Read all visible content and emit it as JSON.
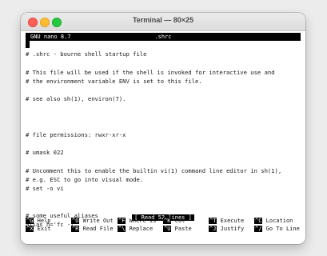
{
  "window": {
    "title": "Terminal — 80×25"
  },
  "nano": {
    "app": "GNU nano 8.7",
    "filename": ".shrc",
    "status": "[ Read 52 lines ]"
  },
  "lines": [
    "",
    "# .shrc - bourne shell startup file",
    "",
    "# This file will be used if the shell is invoked for interactive use and",
    "# the environment variable ENV is set to this file.",
    "",
    "# see also sh(1), environ(7).",
    "",
    "",
    "",
    "# file permissions: rwxr-xr-x",
    "",
    "# umask 022",
    "",
    "# Uncomment this to enable the builtin vi(1) command line editor in sh(1),",
    "# e.g. ESC to go into visual mode.",
    "# set -o vi",
    "",
    "",
    "# some useful aliases",
    "alias h='fc -l'"
  ],
  "shortcuts": [
    [
      {
        "key": "^G",
        "label": "Help"
      },
      {
        "key": "^O",
        "label": "Write Out"
      },
      {
        "key": "^F",
        "label": "Where Is"
      },
      {
        "key": "^K",
        "label": "Cut"
      },
      {
        "key": "^T",
        "label": "Execute"
      },
      {
        "key": "^C",
        "label": "Location"
      }
    ],
    [
      {
        "key": "^X",
        "label": "Exit"
      },
      {
        "key": "^R",
        "label": "Read File"
      },
      {
        "key": "^\\",
        "label": "Replace"
      },
      {
        "key": "^U",
        "label": "Paste"
      },
      {
        "key": "^J",
        "label": "Justify"
      },
      {
        "key": "^/",
        "label": "Go To Line"
      }
    ]
  ]
}
